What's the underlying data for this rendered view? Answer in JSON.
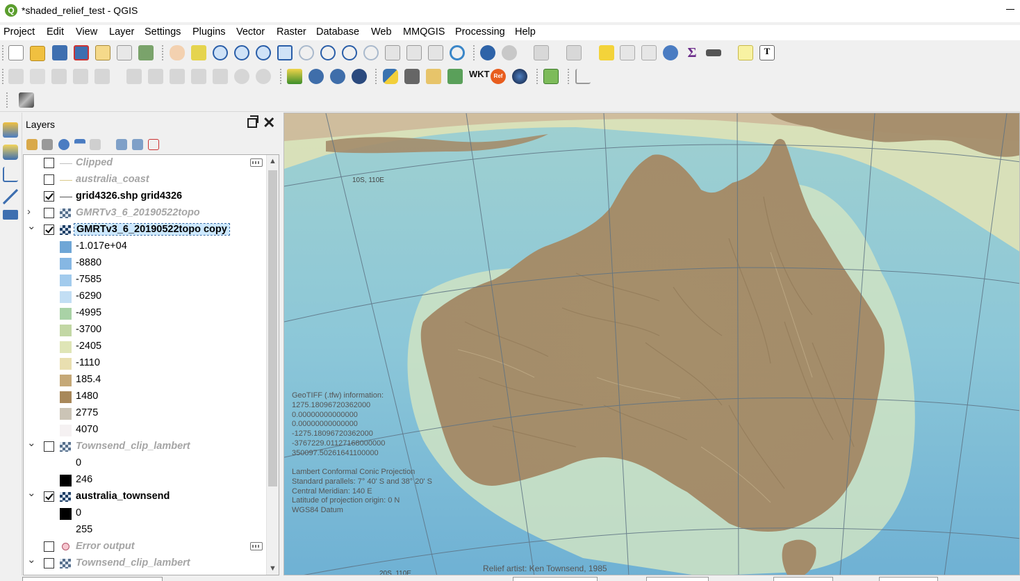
{
  "window": {
    "title": "*shaded_relief_test - QGIS",
    "app_icon": "qgis-logo-icon"
  },
  "menu": [
    "Project",
    "Edit",
    "View",
    "Layer",
    "Settings",
    "Plugins",
    "Vector",
    "Raster",
    "Database",
    "Web",
    "MMQGIS",
    "Processing",
    "Help"
  ],
  "layers_panel": {
    "title": "Layers",
    "items": [
      {
        "kind": "layer",
        "name": "Clipped",
        "checked": false,
        "expanded": null,
        "icon": "line-icon",
        "active": false,
        "badge": true
      },
      {
        "kind": "layer",
        "name": "australia_coast",
        "checked": false,
        "expanded": null,
        "icon": "line-icon",
        "active": false,
        "badge": false
      },
      {
        "kind": "layer",
        "name": "grid4326.shp grid4326",
        "checked": true,
        "expanded": null,
        "icon": "line-icon",
        "active": true,
        "badge": false
      },
      {
        "kind": "layer",
        "name": "GMRTv3_6_20190522topo",
        "checked": false,
        "expanded": false,
        "icon": "raster-icon",
        "active": false,
        "badge": false
      },
      {
        "kind": "layer",
        "name": "GMRTv3_6_20190522topo copy",
        "checked": true,
        "expanded": true,
        "icon": "raster-icon",
        "active": true,
        "badge": false,
        "selected": true
      },
      {
        "kind": "legend",
        "label": "-1.017e+04",
        "color": "#6fa6d6"
      },
      {
        "kind": "legend",
        "label": "-8880",
        "color": "#86b7e3"
      },
      {
        "kind": "legend",
        "label": "-7585",
        "color": "#a2cbed"
      },
      {
        "kind": "legend",
        "label": "-6290",
        "color": "#c2def4"
      },
      {
        "kind": "legend",
        "label": "-4995",
        "color": "#a9d2a6"
      },
      {
        "kind": "legend",
        "label": "-3700",
        "color": "#c2d7a4"
      },
      {
        "kind": "legend",
        "label": "-2405",
        "color": "#dfe5b6"
      },
      {
        "kind": "legend",
        "label": "-1110",
        "color": "#e9dfb0"
      },
      {
        "kind": "legend",
        "label": "185.4",
        "color": "#c5a877"
      },
      {
        "kind": "legend",
        "label": "1480",
        "color": "#a8885a"
      },
      {
        "kind": "legend",
        "label": "2775",
        "color": "#cbc4b6"
      },
      {
        "kind": "legend",
        "label": "4070",
        "color": "#f5f1f2"
      },
      {
        "kind": "layer",
        "name": "Townsend_clip_lambert",
        "checked": false,
        "expanded": true,
        "icon": "raster-icon",
        "active": false,
        "badge": false
      },
      {
        "kind": "legend",
        "label": "0",
        "color": ""
      },
      {
        "kind": "legend",
        "label": "246",
        "color": "#000000"
      },
      {
        "kind": "layer",
        "name": "australia_townsend",
        "checked": true,
        "expanded": true,
        "icon": "raster-icon",
        "active": true,
        "badge": false
      },
      {
        "kind": "legend",
        "label": "0",
        "color": "#000000"
      },
      {
        "kind": "legend",
        "label": "255",
        "color": ""
      },
      {
        "kind": "layer",
        "name": "Error output",
        "checked": false,
        "expanded": null,
        "icon": "point-icon",
        "active": false,
        "badge": true
      },
      {
        "kind": "layer",
        "name": "Townsend_clip_lambert",
        "checked": false,
        "expanded": true,
        "icon": "raster-icon",
        "active": false,
        "badge": false
      }
    ]
  },
  "map": {
    "grid_labels": [
      "10S, 110E",
      "20S, 110E"
    ],
    "geotiff_info": [
      "GeoTIFF (.tfw) information:",
      "1275.18096720362000",
      "0.00000000000000",
      "0.00000000000000",
      "-1275.18096720362000",
      "-3767229.01127168000000",
      "350097.50261641100000"
    ],
    "projection_info": [
      "Lambert Conformal Conic Projection",
      "Standard parallels: 7° 40' S and 38° 20' S",
      "Central Meridian: 140 E",
      "Latitude of projection origin: 0 N",
      "WGS84 Datum"
    ],
    "credit": "Relief artist: Ken Townsend, 1985"
  }
}
